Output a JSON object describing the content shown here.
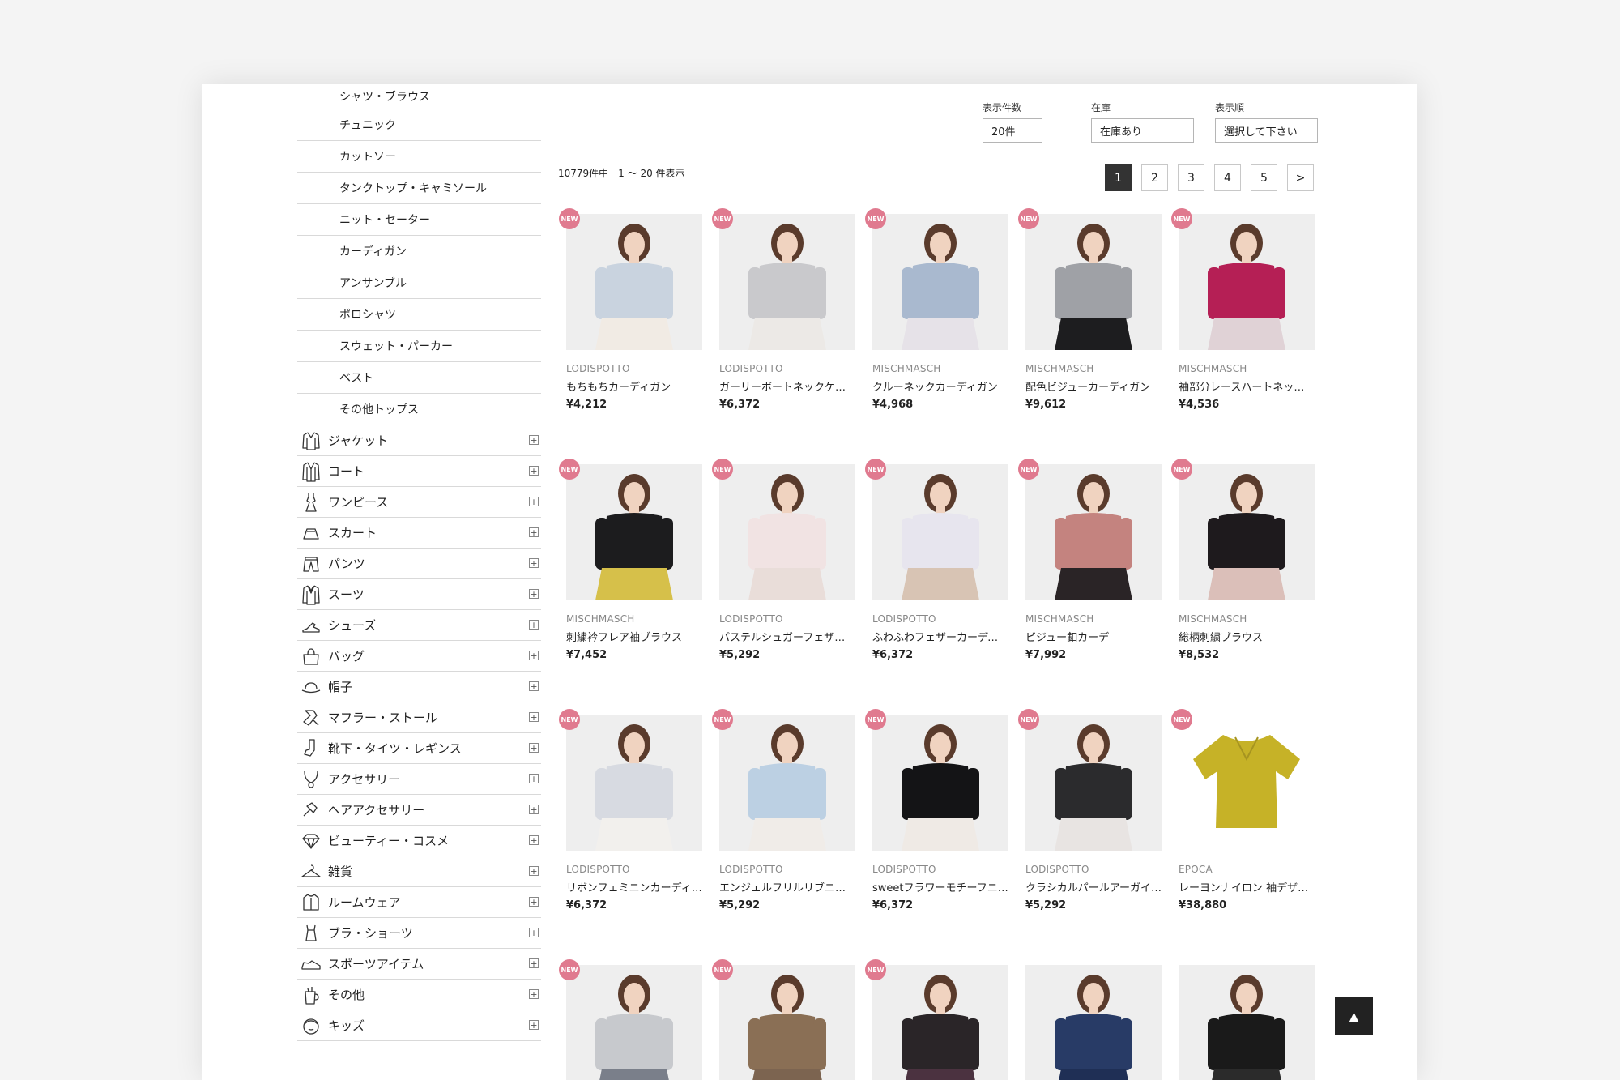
{
  "sidebar": {
    "subcategories": [
      "シャツ・ブラウス",
      "チュニック",
      "カットソー",
      "タンクトップ・キャミソール",
      "ニット・セーター",
      "カーディガン",
      "アンサンブル",
      "ポロシャツ",
      "スウェット・パーカー",
      "ベスト",
      "その他トップス"
    ],
    "categories": [
      {
        "label": "ジャケット",
        "icon": "jacket-icon"
      },
      {
        "label": "コート",
        "icon": "coat-icon"
      },
      {
        "label": "ワンピース",
        "icon": "dress-icon"
      },
      {
        "label": "スカート",
        "icon": "skirt-icon"
      },
      {
        "label": "パンツ",
        "icon": "pants-icon"
      },
      {
        "label": "スーツ",
        "icon": "suit-icon"
      },
      {
        "label": "シューズ",
        "icon": "shoe-icon"
      },
      {
        "label": "バッグ",
        "icon": "bag-icon"
      },
      {
        "label": "帽子",
        "icon": "hat-icon"
      },
      {
        "label": "マフラー・ストール",
        "icon": "scarf-icon"
      },
      {
        "label": "靴下・タイツ・レギンス",
        "icon": "sock-icon"
      },
      {
        "label": "アクセサリー",
        "icon": "necklace-icon"
      },
      {
        "label": "ヘアアクセサリー",
        "icon": "hair-accessory-icon"
      },
      {
        "label": "ビューティー・コスメ",
        "icon": "diamond-icon"
      },
      {
        "label": "雑貨",
        "icon": "hanger-icon"
      },
      {
        "label": "ルームウェア",
        "icon": "roomwear-icon"
      },
      {
        "label": "ブラ・ショーツ",
        "icon": "camisole-icon"
      },
      {
        "label": "スポーツアイテム",
        "icon": "sneaker-icon"
      },
      {
        "label": "その他",
        "icon": "cup-icon"
      },
      {
        "label": "キッズ",
        "icon": "kid-face-icon"
      }
    ],
    "expand_symbol": "+"
  },
  "filters": {
    "count": {
      "label": "表示件数",
      "value": "20件"
    },
    "stock": {
      "label": "在庫",
      "value": "在庫あり"
    },
    "sort": {
      "label": "表示順",
      "value": "選択して下さい"
    }
  },
  "results": {
    "summary": "10779件中　1 〜 20 件表示"
  },
  "pagination": {
    "pages": [
      "1",
      "2",
      "3",
      "4",
      "5"
    ],
    "next": ">",
    "current": "1"
  },
  "badge_text": "NEW",
  "products": [
    {
      "brand": "LODISPOTTO",
      "name": "もちもちカーディガン",
      "price": "¥4,212",
      "new": true,
      "top": "#c9d3df",
      "bottom": "#f1ebe4"
    },
    {
      "brand": "LODISPOTTO",
      "name": "ガーリーボートネックケーブル",
      "price": "¥6,372",
      "new": true,
      "top": "#c9c9cc",
      "bottom": "#ece9e6"
    },
    {
      "brand": "MISCHMASCH",
      "name": "クルーネックカーディガン",
      "price": "¥4,968",
      "new": true,
      "top": "#a9b9cf",
      "bottom": "#e6e2e8"
    },
    {
      "brand": "MISCHMASCH",
      "name": "配色ビジューカーディガン",
      "price": "¥9,612",
      "new": true,
      "top": "#9fa1a6",
      "bottom": "#1d1d1f"
    },
    {
      "brand": "MISCHMASCH",
      "name": "袖部分レースハートネックニット",
      "price": "¥4,536",
      "new": true,
      "top": "#b51f55",
      "bottom": "#e0d2d6"
    },
    {
      "brand": "MISCHMASCH",
      "name": "刺繍衿フレア袖ブラウス",
      "price": "¥7,452",
      "new": true,
      "top": "#1c1c1e",
      "bottom": "#d6c04a"
    },
    {
      "brand": "LODISPOTTO",
      "name": "パステルシュガーフェザーニット",
      "price": "¥5,292",
      "new": true,
      "top": "#f1e3e3",
      "bottom": "#e9ddd9"
    },
    {
      "brand": "LODISPOTTO",
      "name": "ふわふわフェザーカーディガン",
      "price": "¥6,372",
      "new": true,
      "top": "#e7e5ee",
      "bottom": "#d8c4b4"
    },
    {
      "brand": "MISCHMASCH",
      "name": "ビジュー釦カーデ",
      "price": "¥7,992",
      "new": true,
      "top": "#c4837f",
      "bottom": "#2a2426"
    },
    {
      "brand": "MISCHMASCH",
      "name": "総柄刺繍ブラウス",
      "price": "¥8,532",
      "new": true,
      "top": "#1e1a1d",
      "bottom": "#dbbfb9"
    },
    {
      "brand": "LODISPOTTO",
      "name": "リボンフェミニンカーディガン",
      "price": "¥6,372",
      "new": true,
      "top": "#d7dae1",
      "bottom": "#f2f0ed"
    },
    {
      "brand": "LODISPOTTO",
      "name": "エンジェルフリルリブニット",
      "price": "¥5,292",
      "new": true,
      "top": "#bcd0e3",
      "bottom": "#f0ece8"
    },
    {
      "brand": "LODISPOTTO",
      "name": "sweetフラワーモチーフニット",
      "price": "¥6,372",
      "new": true,
      "top": "#141416",
      "bottom": "#efeae5"
    },
    {
      "brand": "LODISPOTTO",
      "name": "クラシカルパールアーガイルニット",
      "price": "¥5,292",
      "new": true,
      "top": "#2b2b2d",
      "bottom": "#e8e4e2"
    },
    {
      "brand": "EPOCA",
      "name": "レーヨンナイロン 袖デザインニット",
      "price": "¥38,880",
      "new": true,
      "top": "#c6b227",
      "bottom": "#f3f3f3"
    },
    {
      "brand": "",
      "name": "",
      "price": "",
      "new": true,
      "top": "#c7c9cd",
      "bottom": "#7a7f8a"
    },
    {
      "brand": "",
      "name": "",
      "price": "",
      "new": true,
      "top": "#8a6f55",
      "bottom": "#7c6450"
    },
    {
      "brand": "",
      "name": "",
      "price": "",
      "new": true,
      "top": "#2a2528",
      "bottom": "#4b3240"
    },
    {
      "brand": "",
      "name": "",
      "price": "",
      "new": false,
      "top": "#283b66",
      "bottom": "#1f2f55"
    },
    {
      "brand": "",
      "name": "",
      "price": "",
      "new": false,
      "top": "#1a1a1a",
      "bottom": "#2b2b2b"
    }
  ],
  "back_to_top": "▲"
}
